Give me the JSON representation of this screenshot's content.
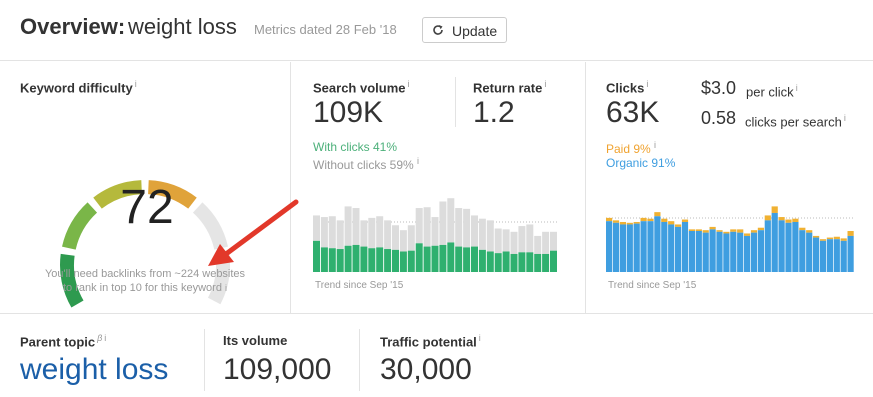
{
  "header": {
    "title_bold": "Overview:",
    "keyword": "weight loss",
    "metrics_date": "Metrics dated 28 Feb '18",
    "update_label": "Update"
  },
  "info_glyph": "i",
  "keyword_difficulty": {
    "label": "Keyword difficulty",
    "value": "72",
    "score": 72,
    "note_line1": "You'll need backlinks from ~224 websites",
    "note_line2": "to rank in top 10 for this keyword"
  },
  "search_volume": {
    "label": "Search volume",
    "value": "109K",
    "with_clicks": "With clicks 41%",
    "without_clicks": "Without clicks 59%",
    "trend": "Trend since Sep '15"
  },
  "return_rate": {
    "label": "Return rate",
    "value": "1.2"
  },
  "clicks": {
    "label": "Clicks",
    "value": "63K",
    "per_click_value": "$3.0",
    "per_click_label": "per click",
    "per_search_value": "0.58",
    "per_search_label": "clicks per search",
    "paid": "Paid 9%",
    "organic": "Organic 91%",
    "trend": "Trend since Sep '15"
  },
  "parent_topic": {
    "label": "Parent topic",
    "beta": "β",
    "value": "weight loss"
  },
  "its_volume": {
    "label": "Its volume",
    "value": "109,000"
  },
  "traffic_potential": {
    "label": "Traffic potential",
    "value": "30,000"
  },
  "colors": {
    "green": "#2fb06f",
    "grey_bar": "#dcdcdc",
    "organic": "#3f9ee0",
    "paid": "#f0b132",
    "link": "#1b5fa8",
    "arrow": "#e2382a"
  },
  "chart_data": [
    {
      "type": "bar",
      "stacked": true,
      "series": [
        {
          "name": "With clicks",
          "values": [
            38,
            30,
            29,
            28,
            32,
            33,
            31,
            29,
            30,
            28,
            27,
            25,
            26,
            35,
            31,
            32,
            33,
            36,
            31,
            30,
            31,
            27,
            25,
            23,
            25,
            22,
            24,
            24,
            22,
            22,
            26
          ]
        },
        {
          "name": "Without clicks",
          "values": [
            31,
            37,
            39,
            35,
            48,
            45,
            32,
            37,
            38,
            35,
            30,
            26,
            31,
            43,
            48,
            35,
            53,
            54,
            47,
            47,
            38,
            38,
            38,
            30,
            27,
            27,
            32,
            34,
            22,
            27,
            23
          ]
        }
      ]
    },
    {
      "type": "bar",
      "stacked": true,
      "series": [
        {
          "name": "Organic",
          "values": [
            62,
            60,
            58,
            58,
            59,
            62,
            62,
            68,
            61,
            58,
            55,
            61,
            50,
            50,
            48,
            52,
            49,
            47,
            49,
            48,
            44,
            48,
            51,
            63,
            72,
            63,
            60,
            61,
            51,
            48,
            42,
            38,
            40,
            40,
            38,
            44
          ]
        },
        {
          "name": "Paid",
          "values": [
            4,
            3,
            3,
            2,
            2,
            4,
            3,
            5,
            4,
            4,
            3,
            3,
            2,
            2,
            3,
            3,
            2,
            2,
            3,
            4,
            3,
            3,
            3,
            6,
            8,
            4,
            4,
            4,
            3,
            3,
            2,
            2,
            2,
            3,
            3,
            6
          ]
        }
      ]
    }
  ]
}
